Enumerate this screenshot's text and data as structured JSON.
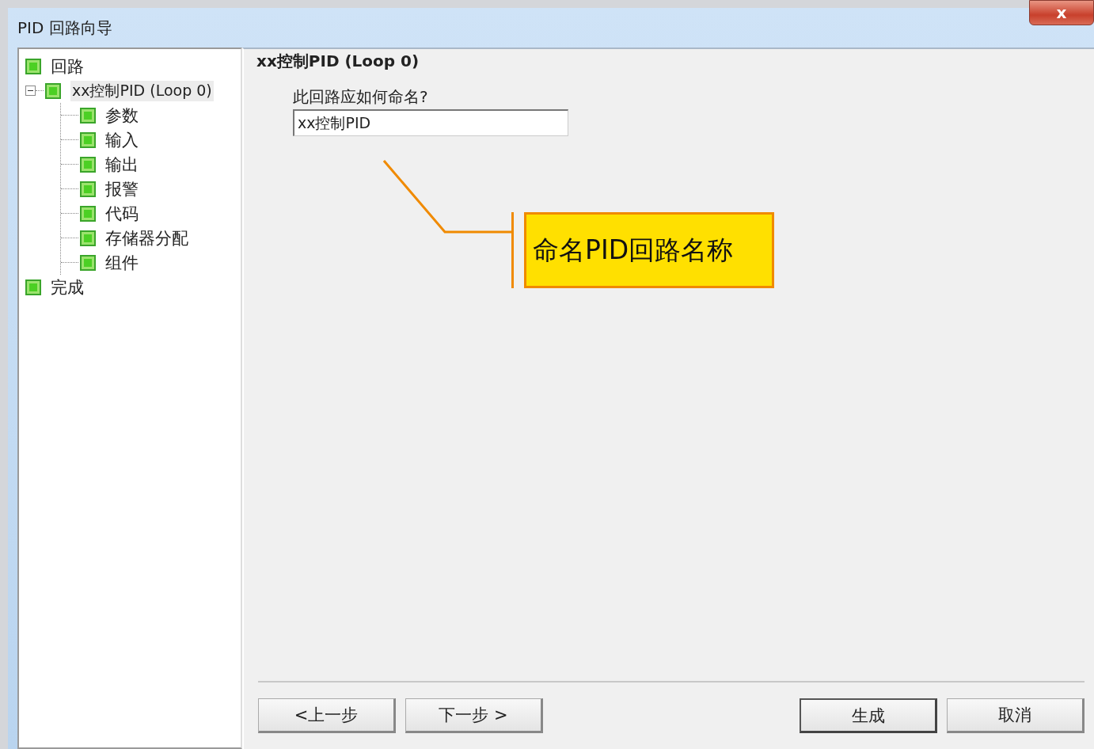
{
  "window": {
    "title": "PID 回路向导",
    "close": "x"
  },
  "tree": [
    {
      "label": "回路",
      "selected": false
    },
    {
      "label": "xx控制PID (Loop 0)",
      "selected": true,
      "expanded": true,
      "children": [
        {
          "label": "参数",
          "selected": false
        },
        {
          "label": "输入",
          "selected": false
        },
        {
          "label": "输出",
          "selected": false
        },
        {
          "label": "报警",
          "selected": false
        },
        {
          "label": "代码",
          "selected": false
        },
        {
          "label": "存储器分配",
          "selected": false
        },
        {
          "label": "组件",
          "selected": false
        }
      ]
    },
    {
      "label": "完成",
      "selected": false
    }
  ],
  "page": {
    "heading": "xx控制PID (Loop 0)",
    "question": "此回路应如何命名?",
    "name_field": {
      "value": "xx控制PID"
    }
  },
  "callout": {
    "text": "命名PID回路名称"
  },
  "buttons": [
    {
      "label": "<上一步",
      "default": false
    },
    {
      "label": "下一步 >",
      "default": false
    },
    {
      "label": "生成",
      "default": true
    },
    {
      "label": "取消",
      "default": false
    }
  ]
}
